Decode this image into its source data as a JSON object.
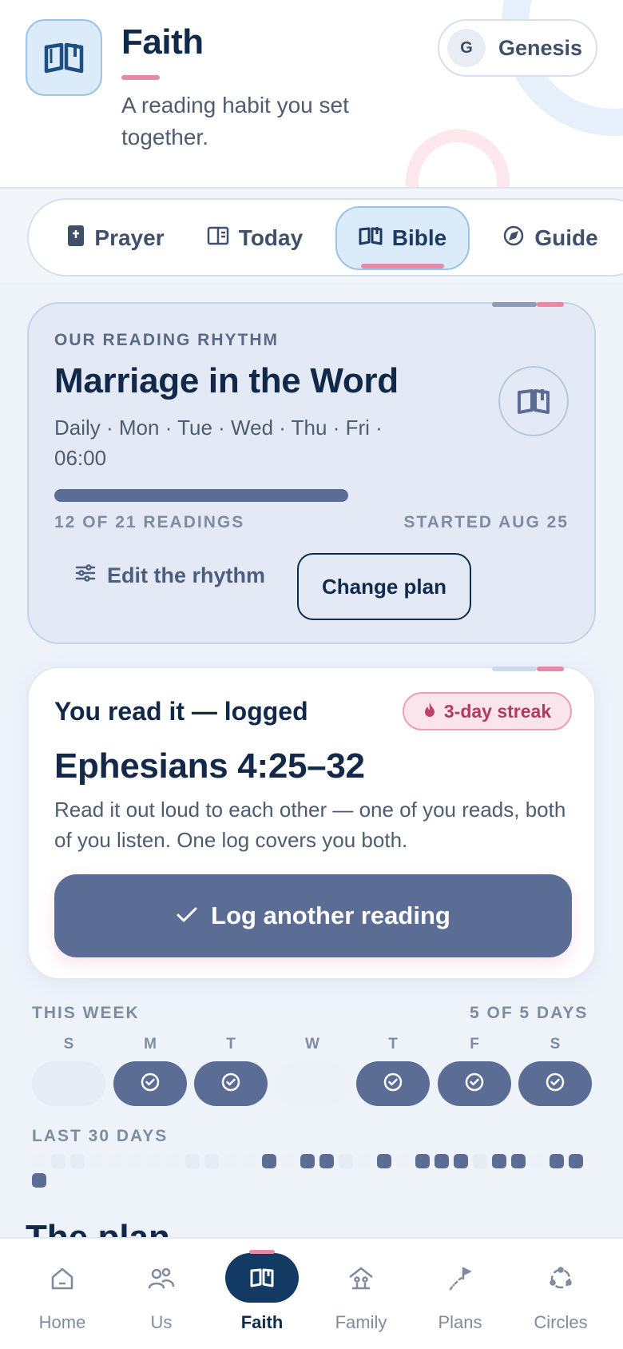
{
  "header": {
    "title": "Faith",
    "subtitle": "A reading habit you set together.",
    "user": {
      "initial": "G",
      "name": "Genesis"
    }
  },
  "tabs": [
    {
      "label": "Prayer",
      "icon": "prayer-book-icon",
      "active": false
    },
    {
      "label": "Today",
      "icon": "reader-icon",
      "active": false
    },
    {
      "label": "Bible",
      "icon": "open-book-icon",
      "active": true
    },
    {
      "label": "Guide",
      "icon": "compass-icon",
      "active": false
    }
  ],
  "rhythm": {
    "eyebrow": "OUR READING RHYTHM",
    "title": "Marriage in the Word",
    "schedule": "Daily · Mon · Tue · Wed · Thu · Fri · 06:00",
    "progress_fraction": 0.571,
    "progress_text": "12 OF 21 READINGS",
    "started_text": "STARTED AUG 25",
    "edit_label": "Edit the rhythm",
    "change_label": "Change plan"
  },
  "log": {
    "heading": "You read it — logged",
    "streak": "3-day streak",
    "passage": "Ephesians 4:25–32",
    "text": "Read it out loud to each other — one of you reads, both of you listen. One log covers you both.",
    "button_label": "Log another reading"
  },
  "week": {
    "label": "THIS WEEK",
    "count_text": "5 OF 5 DAYS",
    "days": [
      {
        "letter": "S",
        "state": "empty"
      },
      {
        "letter": "M",
        "state": "done"
      },
      {
        "letter": "T",
        "state": "done"
      },
      {
        "letter": "W",
        "state": "blank"
      },
      {
        "letter": "T",
        "state": "done"
      },
      {
        "letter": "F",
        "state": "done"
      },
      {
        "letter": "S",
        "state": "done"
      }
    ]
  },
  "last30": {
    "label": "LAST 30 DAYS",
    "days": [
      0,
      1,
      1,
      0,
      0,
      0,
      0,
      0,
      1,
      1,
      0,
      0,
      2,
      0,
      2,
      2,
      1,
      0,
      2,
      0,
      2,
      2,
      2,
      1,
      2,
      2,
      0,
      2,
      2,
      2
    ]
  },
  "plan": {
    "heading": "The plan"
  },
  "nav": [
    {
      "label": "Home",
      "icon": "home-icon",
      "active": false
    },
    {
      "label": "Us",
      "icon": "people-icon",
      "active": false
    },
    {
      "label": "Faith",
      "icon": "open-book-icon",
      "active": true
    },
    {
      "label": "Family",
      "icon": "house-family-icon",
      "active": false
    },
    {
      "label": "Plans",
      "icon": "flag-path-icon",
      "active": false
    },
    {
      "label": "Circles",
      "icon": "circle-dots-icon",
      "active": false
    }
  ],
  "colors": {
    "accent_pink": "#e58aa5",
    "primary": "#5b6c95",
    "navy": "#0f2a4a",
    "light_blue": "#dcebfa"
  }
}
